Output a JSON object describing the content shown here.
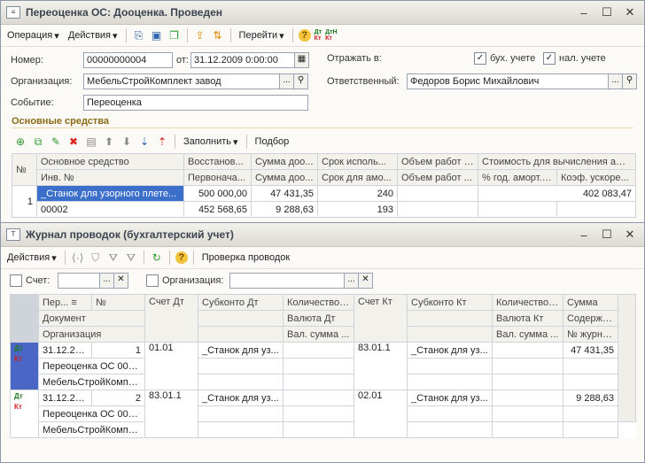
{
  "doc": {
    "title": "Переоценка ОС: Дооценка. Проведен",
    "toolbar": {
      "operation": "Операция",
      "actions": "Действия",
      "goto": "Перейти"
    },
    "number_label": "Номер:",
    "number_value": "00000000004",
    "date_label": "от:",
    "date_value": "31.12.2009  0:00:00",
    "reflect_label": "Отражать в:",
    "buh_label": "бух. учете",
    "nal_label": "нал. учете",
    "org_label": "Организация:",
    "org_value": "МебельСтройКомплект завод",
    "resp_label": "Ответственный:",
    "resp_value": "Федоров Борис Михайлович",
    "event_label": "Событие:",
    "event_value": "Переоценка",
    "section_title": "Основные средства",
    "grid_toolbar": {
      "fill": "Заполнить",
      "select": "Подбор"
    },
    "grid": {
      "headers1": [
        "№",
        "Основное средство",
        "Восстанов...",
        "Сумма доо...",
        "Срок исполь...",
        "Объем работ (...",
        "Стоимость для вычисления амо..."
      ],
      "headers2": [
        "Инв. №",
        "Первонача...",
        "Сумма доо...",
        "Срок для амо...",
        "Объем работ ...",
        "% год. аморт. (...",
        "Коэф. ускоре..."
      ],
      "rows": [
        {
          "n": "1",
          "os": "_Станок для узорного плете...",
          "inv": "00002",
          "c1": "500 000,00",
          "c1b": "452 568,65",
          "c2": "47 431,35",
          "c2b": "9 288,63",
          "c3": "240",
          "c3b": "193",
          "c4": "",
          "c4b": "",
          "c5": "402 083,47",
          "c5b": "",
          "c6b": ""
        }
      ]
    }
  },
  "journal": {
    "title": "Журнал проводок (бухгалтерский учет)",
    "toolbar": {
      "actions": "Действия",
      "check": "Проверка проводок"
    },
    "filter": {
      "account_label": "Счет:",
      "org_label": "Организация:"
    },
    "headers": {
      "period": "Пер...",
      "num": "№",
      "document": "Документ",
      "organization": "Организация",
      "acc_dt": "Счет Дт",
      "sub_dt": "Субконто Дт",
      "qty_dt": "Количество ...",
      "cur_dt": "Валюта Дт",
      "valsum_dt": "Вал. сумма ...",
      "acc_kt": "Счет Кт",
      "sub_kt": "Субконто Кт",
      "qty_kt": "Количество ...",
      "cur_kt": "Валюта Кт",
      "valsum_kt": "Вал. сумма ...",
      "sum": "Сумма",
      "content": "Содержа...",
      "journal_no": "№ журнала"
    },
    "rows": [
      {
        "date": "31.12.20...",
        "n": "1",
        "doc": "Переоценка ОС 000...",
        "org": "МебельСтройКомпл...",
        "acc_dt": "01.01",
        "sub_dt": "_Станок для уз...",
        "acc_kt": "83.01.1",
        "sub_kt": "_Станок для уз...",
        "sum": "47 431,35"
      },
      {
        "date": "31.12.20...",
        "n": "2",
        "doc": "Переоценка ОС 000...",
        "org": "МебельСтройКомпл...",
        "acc_dt": "83.01.1",
        "sub_dt": "_Станок для уз...",
        "acc_kt": "02.01",
        "sub_kt": "_Станок для уз...",
        "sum": "9 288,63"
      }
    ]
  }
}
